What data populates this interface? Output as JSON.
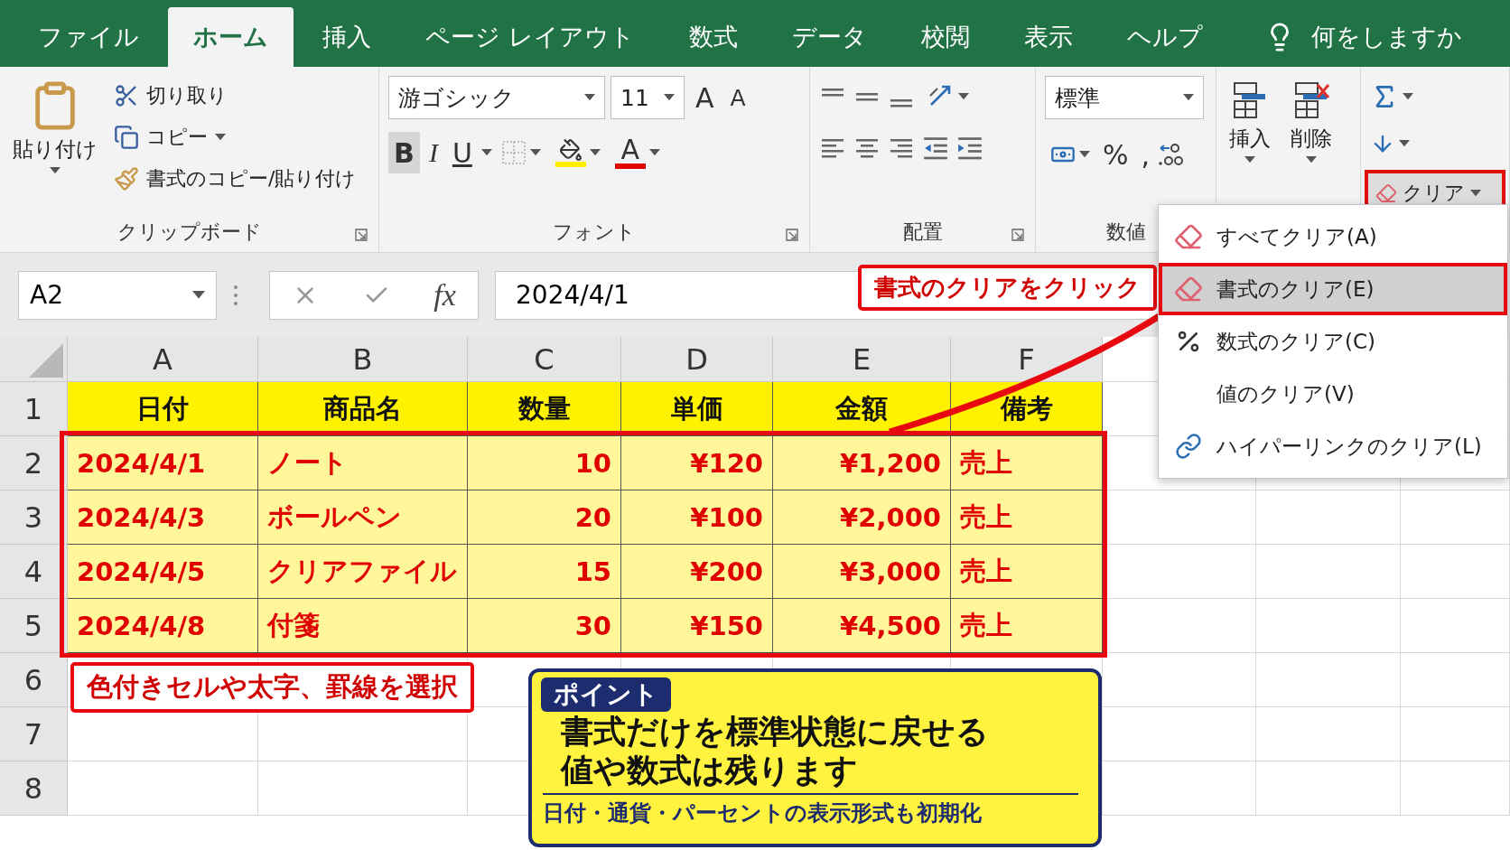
{
  "tabs": [
    {
      "label": "ファイル",
      "selected": false
    },
    {
      "label": "ホーム",
      "selected": true
    },
    {
      "label": "挿入",
      "selected": false
    },
    {
      "label": "ページ レイアウト",
      "selected": false
    },
    {
      "label": "数式",
      "selected": false
    },
    {
      "label": "データ",
      "selected": false
    },
    {
      "label": "校閲",
      "selected": false
    },
    {
      "label": "表示",
      "selected": false
    },
    {
      "label": "ヘルプ",
      "selected": false
    }
  ],
  "tell_me": "何をしますか",
  "ribbon": {
    "clipboard": {
      "paste": "貼り付け",
      "cut": "切り取り",
      "copy": "コピー",
      "format_painter": "書式のコピー/貼り付け",
      "label": "クリップボード"
    },
    "font": {
      "name": "游ゴシック",
      "size": "11",
      "grow": "A",
      "shrink": "A",
      "bold": {
        "text": "B",
        "selected": true
      },
      "italic": {
        "text": "I",
        "selected": false
      },
      "underline": {
        "text": "U",
        "selected": false
      },
      "font_color": "A",
      "label": "フォント"
    },
    "alignment": {
      "label": "配置"
    },
    "number": {
      "format": "標準",
      "percent": "%",
      "comma": ",",
      "label": "数値"
    },
    "cells": {
      "insert": "挿入",
      "delete": "削除"
    },
    "editing": {
      "clear": "クリア"
    }
  },
  "formula_bar": {
    "name_box": "A2",
    "fx": "fx",
    "value": "2024/4/1"
  },
  "sheet": {
    "columns": [
      {
        "letter": "A",
        "numeric": false
      },
      {
        "letter": "B",
        "numeric": false
      },
      {
        "letter": "C",
        "numeric": true
      },
      {
        "letter": "D",
        "numeric": true
      },
      {
        "letter": "E",
        "numeric": true
      },
      {
        "letter": "F",
        "numeric": false
      }
    ],
    "rows": [
      {
        "number": "1",
        "kind": "header",
        "cells": [
          "日付",
          "商品名",
          "数量",
          "単価",
          "金額",
          "備考"
        ]
      },
      {
        "number": "2",
        "kind": "data",
        "cells": [
          "2024/4/1",
          "ノート",
          "10",
          "¥120",
          "¥1,200",
          "売上"
        ]
      },
      {
        "number": "3",
        "kind": "data",
        "cells": [
          "2024/4/3",
          "ボールペン",
          "20",
          "¥100",
          "¥2,000",
          "売上"
        ]
      },
      {
        "number": "4",
        "kind": "data",
        "cells": [
          "2024/4/5",
          "クリアファイル",
          "15",
          "¥200",
          "¥3,000",
          "売上"
        ]
      },
      {
        "number": "5",
        "kind": "data",
        "cells": [
          "2024/4/8",
          "付箋",
          "30",
          "¥150",
          "¥4,500",
          "売上"
        ]
      },
      {
        "number": "6",
        "kind": "empty"
      },
      {
        "number": "7",
        "kind": "empty"
      },
      {
        "number": "8",
        "kind": "empty"
      }
    ]
  },
  "clear_menu": [
    {
      "kind": "eraser",
      "label": "すべてクリア(A)",
      "selected": false
    },
    {
      "kind": "eraser",
      "label": "書式のクリア(E)",
      "selected": true
    },
    {
      "kind": "percent",
      "label": "数式のクリア(C)",
      "selected": false
    },
    {
      "kind": "none",
      "label": "値のクリア(V)",
      "selected": false
    },
    {
      "kind": "link",
      "label": "ハイパーリンクのクリア(L)",
      "selected": false
    }
  ],
  "annotations": {
    "selection_note": "色付きセルや太字、罫線を選択",
    "click_note": "書式のクリアをクリック",
    "point": {
      "badge": "ポイント",
      "lines": [
        "書式だけを標準状態に戻せる",
        "値や数式は残ります"
      ],
      "footnote": "日付・通貨・パーセントの表示形式も初期化"
    }
  }
}
